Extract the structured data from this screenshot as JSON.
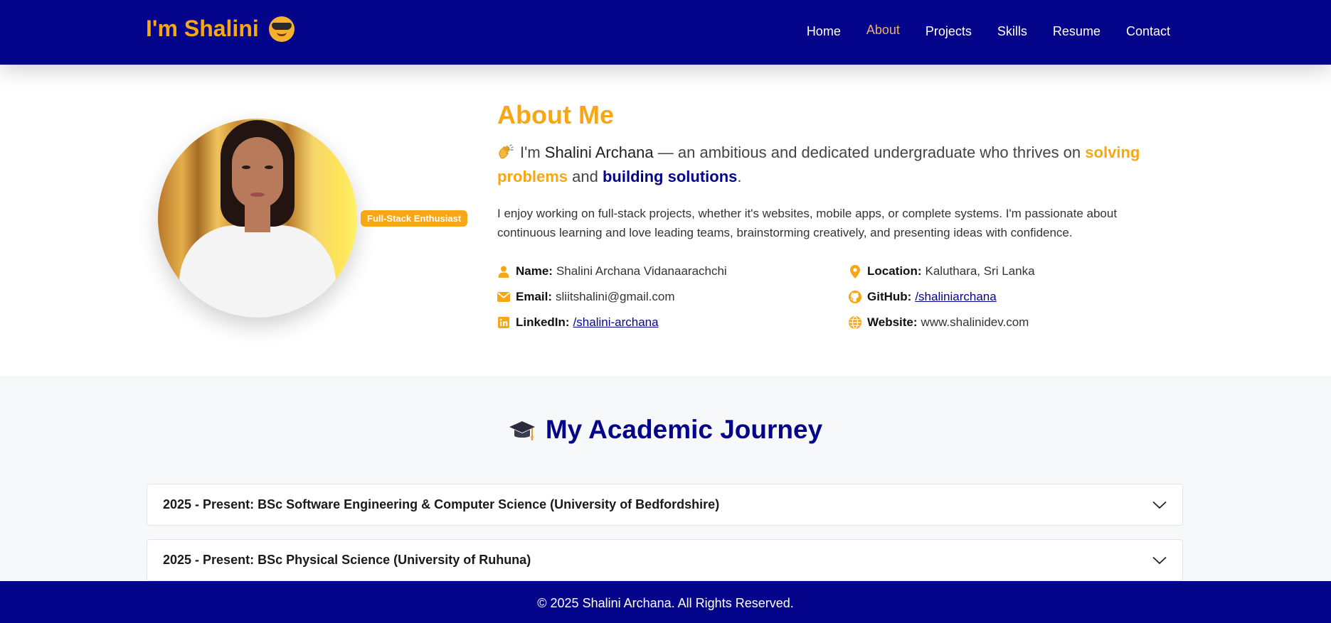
{
  "nav": {
    "brand": "I'm Shalini",
    "brand_icon": "sunglasses-face-emoji",
    "links": [
      {
        "label": "Home"
      },
      {
        "label": "About",
        "active": true
      },
      {
        "label": "Projects"
      },
      {
        "label": "Skills"
      },
      {
        "label": "Resume"
      },
      {
        "label": "Contact"
      }
    ]
  },
  "about": {
    "badge": "Full-Stack Enthusiast",
    "title": "About Me",
    "intro": {
      "prefix": "I'm ",
      "name": "Shalini Archana",
      "middle": " — an ambitious and dedicated undergraduate who thrives on ",
      "highlight1": "solving problems",
      "connector": " and ",
      "highlight2": "building solutions",
      "suffix": "."
    },
    "description": "I enjoy working on full-stack projects, whether it's websites, mobile apps, or complete systems. I'm passionate about continuous learning and love leading teams, brainstorming creatively, and presenting ideas with confidence.",
    "info_left": [
      {
        "icon": "user-icon",
        "label": "Name:",
        "value": "Shalini Archana Vidanaarachchi"
      },
      {
        "icon": "envelope-icon",
        "label": "Email:",
        "value": "sliitshalini@gmail.com"
      },
      {
        "icon": "linkedin-icon",
        "label": "LinkedIn:",
        "value": "/shalini-archana",
        "link": true
      }
    ],
    "info_right": [
      {
        "icon": "location-pin-icon",
        "label": "Location:",
        "value": "Kaluthara, Sri Lanka"
      },
      {
        "icon": "github-icon",
        "label": "GitHub:",
        "value": "/shaliniarchana",
        "link": true
      },
      {
        "icon": "globe-icon",
        "label": "Website:",
        "value": "www.shalinidev.com"
      }
    ]
  },
  "academic": {
    "title": "My Academic Journey",
    "items": [
      {
        "label": "2025 - Present: BSc Software Engineering & Computer Science (University of Bedfordshire)"
      },
      {
        "label": "2025 - Present: BSc Physical Science (University of Ruhuna)"
      }
    ]
  },
  "footer": {
    "text": "© 2025 Shalini Archana. All Rights Reserved."
  },
  "colors": {
    "primary": "#04058a",
    "accent": "#f7a616"
  }
}
